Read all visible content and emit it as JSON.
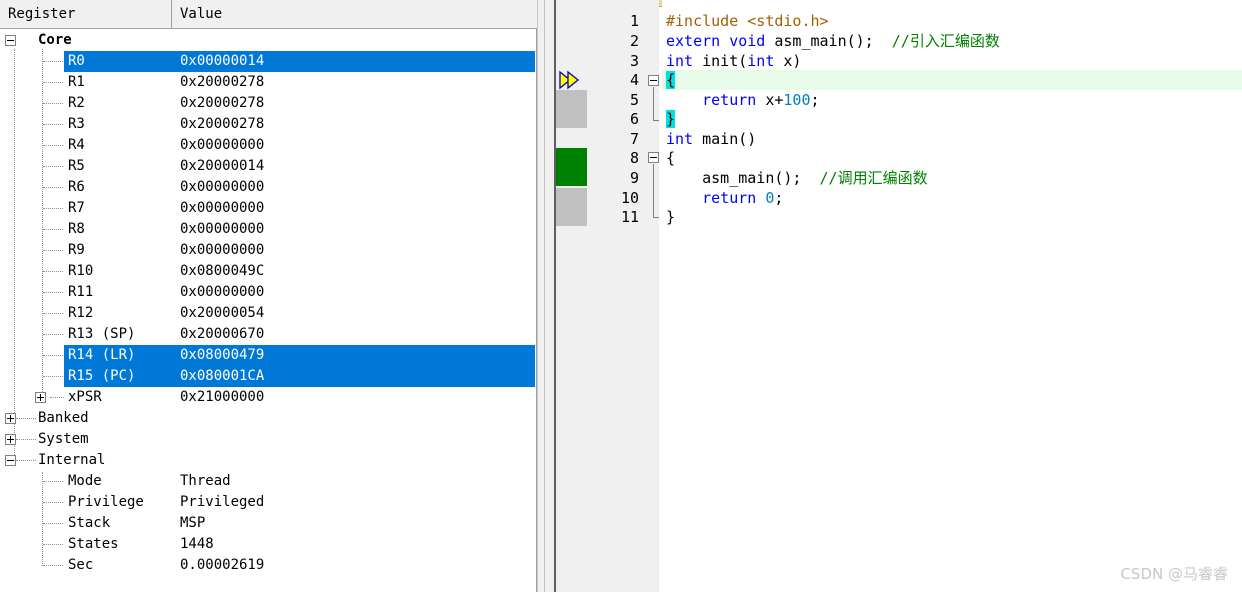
{
  "registers": {
    "header": {
      "register": "Register",
      "value": "Value"
    },
    "core_label": "Core",
    "core": [
      {
        "name": "R0",
        "value": "0x00000014",
        "selected": true
      },
      {
        "name": "R1",
        "value": "0x20000278",
        "selected": false
      },
      {
        "name": "R2",
        "value": "0x20000278",
        "selected": false
      },
      {
        "name": "R3",
        "value": "0x20000278",
        "selected": false
      },
      {
        "name": "R4",
        "value": "0x00000000",
        "selected": false
      },
      {
        "name": "R5",
        "value": "0x20000014",
        "selected": false
      },
      {
        "name": "R6",
        "value": "0x00000000",
        "selected": false
      },
      {
        "name": "R7",
        "value": "0x00000000",
        "selected": false
      },
      {
        "name": "R8",
        "value": "0x00000000",
        "selected": false
      },
      {
        "name": "R9",
        "value": "0x00000000",
        "selected": false
      },
      {
        "name": "R10",
        "value": "0x0800049C",
        "selected": false
      },
      {
        "name": "R11",
        "value": "0x00000000",
        "selected": false
      },
      {
        "name": "R12",
        "value": "0x20000054",
        "selected": false
      },
      {
        "name": "R13 (SP)",
        "value": "0x20000670",
        "selected": false
      },
      {
        "name": "R14 (LR)",
        "value": "0x08000479",
        "selected": true
      },
      {
        "name": "R15 (PC)",
        "value": "0x080001CA",
        "selected": true
      }
    ],
    "xpsr": {
      "name": "xPSR",
      "value": "0x21000000"
    },
    "groups": [
      "Banked",
      "System"
    ],
    "internal_label": "Internal",
    "internal": [
      {
        "name": "Mode",
        "value": "Thread"
      },
      {
        "name": "Privilege",
        "value": "Privileged"
      },
      {
        "name": "Stack",
        "value": "MSP"
      },
      {
        "name": "States",
        "value": "1448"
      },
      {
        "name": "Sec",
        "value": "0.00002619"
      }
    ],
    "selection_color": "#0078d7"
  },
  "editor": {
    "line_numbers": [
      "1",
      "2",
      "3",
      "4",
      "5",
      "6",
      "7",
      "8",
      "9",
      "10",
      "11"
    ],
    "code": {
      "l1_pp": "#include <stdio.h>",
      "l2_kw": "extern void",
      "l2_text": " asm_main();  ",
      "l2_comment": "//引入汇编函数",
      "l3_kw1": "int",
      "l3_text1": " init(",
      "l3_kw2": "int",
      "l3_text2": " x)",
      "l4_brace": "{",
      "l5_kw": "return",
      "l5_text": " x+",
      "l5_num": "100",
      "l5_end": ";",
      "l6_brace": "}",
      "l7_kw": "int",
      "l7_text": " main()",
      "l8_brace": "{",
      "l9_text": "asm_main();  ",
      "l9_comment": "//调用汇编函数",
      "l10_kw": "return",
      "l10_num": "0",
      "l10_end": ";",
      "l11_brace": "}"
    },
    "execution_arrow_line": 4,
    "colors": {
      "keyword": "#0000ff",
      "preprocessor": "#a06000",
      "comment": "#008000",
      "number": "#0080c0",
      "breakpoint_green": "#008000",
      "coverage_gray": "#c0c0c0"
    }
  },
  "watermark": "CSDN @马睿睿"
}
